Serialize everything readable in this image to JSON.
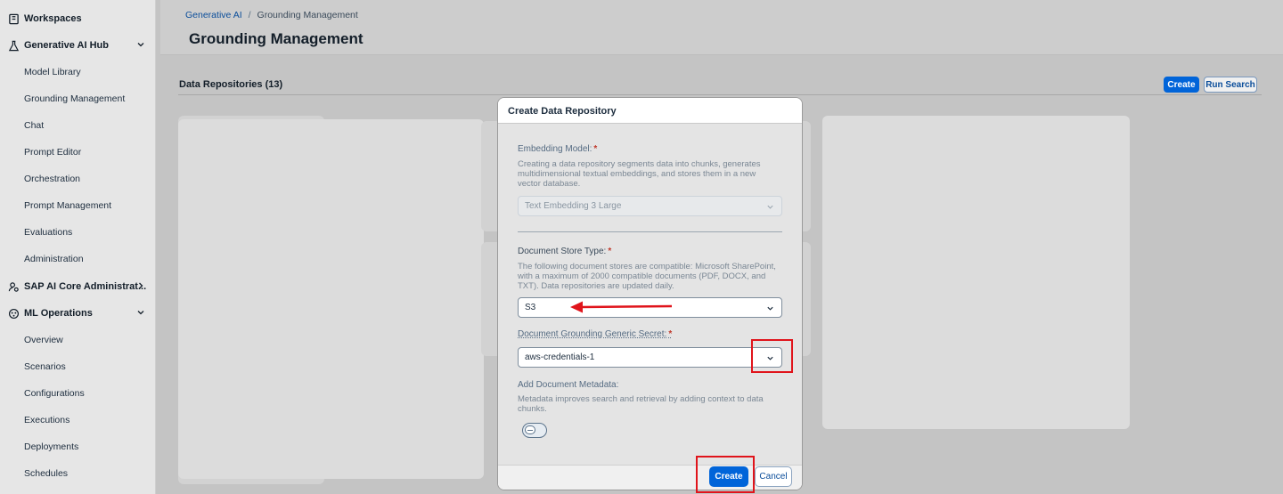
{
  "sidebar": {
    "items": [
      {
        "label": "Workspaces",
        "type": "top",
        "icon": "workspaces-icon"
      },
      {
        "label": "Generative AI Hub",
        "type": "top",
        "icon": "flask-icon",
        "chevron": "down"
      },
      {
        "label": "Model Library",
        "type": "sub"
      },
      {
        "label": "Grounding Management",
        "type": "sub"
      },
      {
        "label": "Chat",
        "type": "sub"
      },
      {
        "label": "Prompt Editor",
        "type": "sub"
      },
      {
        "label": "Orchestration",
        "type": "sub"
      },
      {
        "label": "Prompt Management",
        "type": "sub"
      },
      {
        "label": "Evaluations",
        "type": "sub"
      },
      {
        "label": "Administration",
        "type": "sub"
      },
      {
        "label": "SAP AI Core Administrat...",
        "type": "top",
        "icon": "admin-user-icon",
        "chevron": "right"
      },
      {
        "label": "ML Operations",
        "type": "top",
        "icon": "ml-ops-icon",
        "chevron": "down"
      },
      {
        "label": "Overview",
        "type": "sub"
      },
      {
        "label": "Scenarios",
        "type": "sub"
      },
      {
        "label": "Configurations",
        "type": "sub"
      },
      {
        "label": "Executions",
        "type": "sub"
      },
      {
        "label": "Deployments",
        "type": "sub"
      },
      {
        "label": "Schedules",
        "type": "sub"
      }
    ]
  },
  "header": {
    "breadcrumb": {
      "link": "Generative AI",
      "separator": "/",
      "current": "Grounding Management"
    },
    "title": "Grounding Management"
  },
  "content": {
    "section_title": "Data Repositories (13)",
    "create_label": "Create",
    "run_search_label": "Run Search"
  },
  "dialog": {
    "title": "Create Data Repository",
    "embedding": {
      "label": "Embedding Model:",
      "required": "*",
      "help": "Creating a data repository segments data into chunks, generates multidimensional textual embeddings, and stores them in a new vector database.",
      "value": "Text Embedding 3 Large"
    },
    "store_type": {
      "label": "Document Store Type:",
      "required": "*",
      "help": "The following document stores are compatible: Microsoft SharePoint, with a maximum of 2000 compatible documents (PDF, DOCX, and TXT). Data repositories are updated daily.",
      "value": "S3"
    },
    "secret": {
      "label": "Document Grounding Generic Secret:",
      "required": "*",
      "value": "aws-credentials-1"
    },
    "metadata": {
      "label": "Add Document Metadata:",
      "help": "Metadata improves search and retrieval by adding context to data chunks."
    },
    "create_label": "Create",
    "cancel_label": "Cancel"
  },
  "colors": {
    "accent": "#0064d9",
    "annotation": "#e0141b"
  }
}
